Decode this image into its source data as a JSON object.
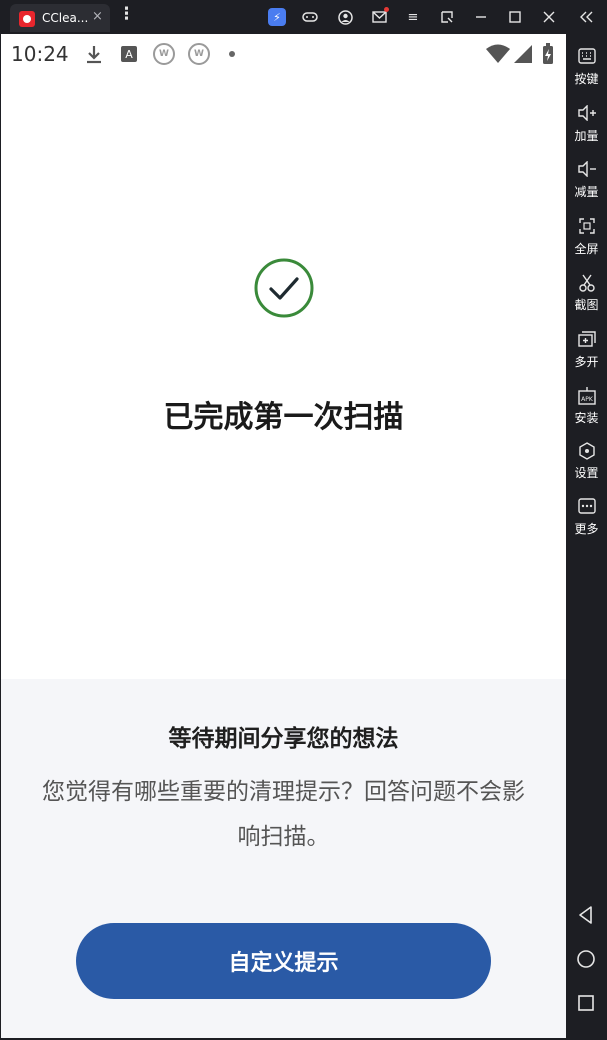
{
  "titlebar": {
    "tab_title": "CClea...",
    "tab_close": "×",
    "menu": "⋮",
    "icons": [
      "bolt-icon",
      "gamepad-icon",
      "account-icon",
      "mail-icon",
      "hamburger-icon",
      "restore-icon",
      "minimize-icon",
      "maximize-icon",
      "close-icon",
      "collapse-icon"
    ]
  },
  "statusbar": {
    "time": "10:24",
    "icons": [
      "download-icon",
      "a-icon",
      "w-icon",
      "w-icon",
      "dot-icon",
      "wifi-icon",
      "signal-icon",
      "battery-icon"
    ]
  },
  "main": {
    "headline": "已完成第一次扫描",
    "check_color": "#3a8a3a"
  },
  "panel": {
    "title": "等待期间分享您的想法",
    "description": "您觉得有哪些重要的清理提示？回答问题不会影响扫描。",
    "button_label": "自定义提示",
    "button_color": "#2a5aa6"
  },
  "sidebar": {
    "items": [
      {
        "label": "按键",
        "icon": "keyboard-icon"
      },
      {
        "label": "加量",
        "icon": "volume-up-icon"
      },
      {
        "label": "减量",
        "icon": "volume-down-icon"
      },
      {
        "label": "全屏",
        "icon": "fullscreen-icon"
      },
      {
        "label": "截图",
        "icon": "scissors-icon"
      },
      {
        "label": "多开",
        "icon": "multi-instance-icon"
      },
      {
        "label": "安装",
        "icon": "apk-icon"
      },
      {
        "label": "设置",
        "icon": "settings-icon"
      },
      {
        "label": "更多",
        "icon": "more-icon"
      }
    ],
    "nav": [
      "back-icon",
      "home-icon",
      "recents-icon"
    ]
  }
}
